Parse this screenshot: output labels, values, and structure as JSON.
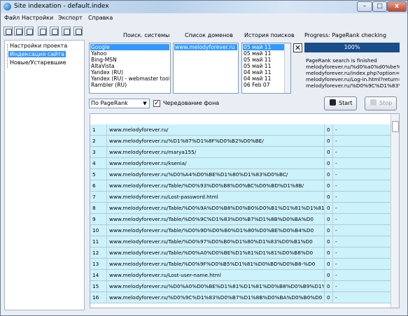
{
  "window": {
    "title": "Site indexation - default.index",
    "min": "–",
    "max": "□",
    "close": "x"
  },
  "menu": [
    "Файл",
    "Настройки",
    "Экспорт",
    "Справка"
  ],
  "tree": {
    "items": [
      "Настройки проекта",
      "Индексация сайта",
      "Новые/Устаревшие"
    ],
    "selected_index": 1
  },
  "headers": {
    "engines": "Поиск. системы",
    "domains": "Список доменов",
    "history": "История поисков",
    "progress": "Progress: PageRank checking"
  },
  "engines": {
    "items": [
      "Google",
      "Yahoo",
      "Bing-MSN",
      "AltaVista",
      "Yandex (RU)",
      "Yandex (RU) - webmaster tools",
      "Rambler (RU)"
    ],
    "selected_index": 0
  },
  "domains": {
    "items": [
      "www.melodyforever.ru"
    ],
    "selected_index": 0
  },
  "history": {
    "items": [
      "05 май 11",
      "05 май 11",
      "05 май 11",
      "05 май 11",
      "04 май 11",
      "04 май 11",
      "06 Feb 07"
    ],
    "selected_index": 0
  },
  "progress": {
    "label": "100%",
    "value_percent": 100
  },
  "log": [
    "PageRank search is finished",
    "melodyforever.ru/%d0%a0%d0%be%d1",
    "melodyforever.ru/index.php?option=cc",
    "melodyforever.ru/Log-in.html?return=al",
    "melodyforever.ru/%D0%9C%D1%83%D"
  ],
  "controls": {
    "sort_value": "По PageRank",
    "checkbox_label": "Чередование фона",
    "checkbox_checked": true,
    "start_label": "Start",
    "stop_label": "Stop"
  },
  "colors": {
    "row_bg": "#ccf2fb",
    "selection": "#3399ff",
    "progress_bar": "#1a4e8a"
  },
  "table": {
    "rows": [
      {
        "num": "1",
        "url": "www.melodyforever.ru/",
        "pr": "0",
        "extra": "-"
      },
      {
        "num": "2",
        "url": "www.melodyforever.ru/%D1%87%D1%8F%D0%B2%D0%BE/",
        "pr": "0",
        "extra": "-"
      },
      {
        "num": "3",
        "url": "www.melodyforever.ru/marya155/",
        "pr": "0",
        "extra": "-"
      },
      {
        "num": "4",
        "url": "www.melodyforever.ru/ksenia/",
        "pr": "0",
        "extra": "-"
      },
      {
        "num": "5",
        "url": "www.melodyforever.ru/%D0%A4%D0%BE%D1%80%D1%83%D0%BC/",
        "pr": "0",
        "extra": "-"
      },
      {
        "num": "6",
        "url": "www.melodyforever.ru/Table/%D0%93%D0%B8%D0%BC%D0%BD%D1%8B/",
        "pr": "0",
        "extra": "-"
      },
      {
        "num": "7",
        "url": "www.melodyforever.ru/Lost-password.html",
        "pr": "0",
        "extra": "-"
      },
      {
        "num": "8",
        "url": "www.melodyforever.ru/Table/%D0%9A%D0%B8%D0%B0%D0%B1%D1%81%D1%81%D0",
        "pr": "0",
        "extra": "-"
      },
      {
        "num": "9",
        "url": "www.melodyforever.ru/Table/%D0%9C%D1%83%D0%B7%D1%8B%D0%BA%D0",
        "pr": "0",
        "extra": "-"
      },
      {
        "num": "10",
        "url": "www.melodyforever.ru/Table/%D0%9D%D0%B0%D1%80%D0%BE%D0%B4%D0",
        "pr": "0",
        "extra": "-"
      },
      {
        "num": "11",
        "url": "www.melodyforever.ru/Table/%D0%97%D0%B0%D1%80%D1%83%D0%B1%D0",
        "pr": "0",
        "extra": "-"
      },
      {
        "num": "12",
        "url": "www.melodyforever.ru/Table/%D0%A0%D0%BE%D1%81%D1%81%D0%B8%D0",
        "pr": "0",
        "extra": "-"
      },
      {
        "num": "13",
        "url": "www.melodyforever.ru/Table/%D0%9F%D0%B5%D1%81%D0%BD%D0%B8-%D0",
        "pr": "0",
        "extra": "-"
      },
      {
        "num": "14",
        "url": "www.melodyforever.ru/Lost-user-name.html",
        "pr": "0",
        "extra": "-"
      },
      {
        "num": "15",
        "url": "www.melodyforever.ru/%D0%A0%D0%BE%D1%81%D1%81%D0%B8%D0%B9%D1%81%D0%BA%",
        "pr": "0",
        "extra": "-"
      },
      {
        "num": "16",
        "url": "www.melodyforever.ru/%D0%9C%D1%83%D0%B7%D1%8B%D0%BA%D0%B0%D0",
        "pr": "0",
        "extra": "-"
      }
    ]
  }
}
